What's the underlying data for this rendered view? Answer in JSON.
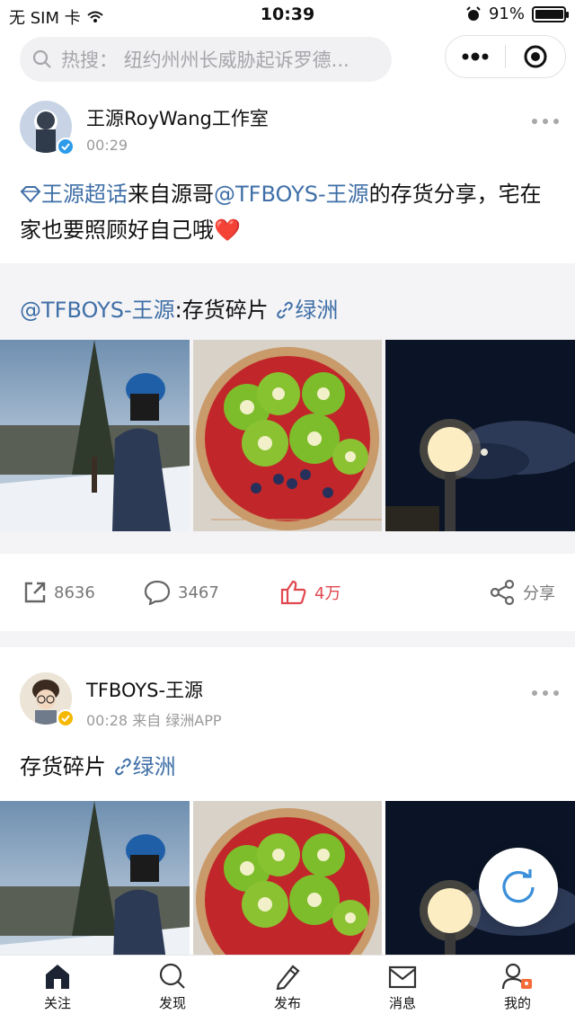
{
  "status_bar": {
    "carrier": "无 SIM 卡",
    "time": "10:39",
    "battery": "91%",
    "battery_level": 0.91
  },
  "search": {
    "prefix": "热搜：",
    "placeholder": "纽约州州长威胁起诉罗德..."
  },
  "feed": [
    {
      "author": "王源RoyWang工作室",
      "meta": "00:29",
      "text_parts": [
        "王源超话",
        "来自源哥",
        "@TFBOYS-王源",
        "的存货分享，宅在家也要照顾好自己哦",
        "❤️"
      ],
      "repost": {
        "author_link": "@TFBOYS-王源",
        "text": ":存货碎片 ",
        "location_link": "绿洲"
      },
      "actions": {
        "repost_count": "8636",
        "comment_count": "3467",
        "like_count": "4万",
        "share_label": "分享"
      }
    },
    {
      "author": "TFBOYS-王源",
      "meta": "00:28 来自 绿洲APP",
      "text": "存货碎片 ",
      "location_link": "绿洲"
    }
  ],
  "tabbar": [
    {
      "label": "关注",
      "icon": "home-icon"
    },
    {
      "label": "发现",
      "icon": "search-icon"
    },
    {
      "label": "发布",
      "icon": "pencil-icon"
    },
    {
      "label": "消息",
      "icon": "mail-icon"
    },
    {
      "label": "我的",
      "icon": "profile-icon"
    }
  ],
  "colors": {
    "link": "#3f6fa7",
    "like": "#e0484f",
    "verified_blue": "#2b9bea",
    "verified_gold": "#f5b800",
    "refresh": "#3b8fd9"
  }
}
